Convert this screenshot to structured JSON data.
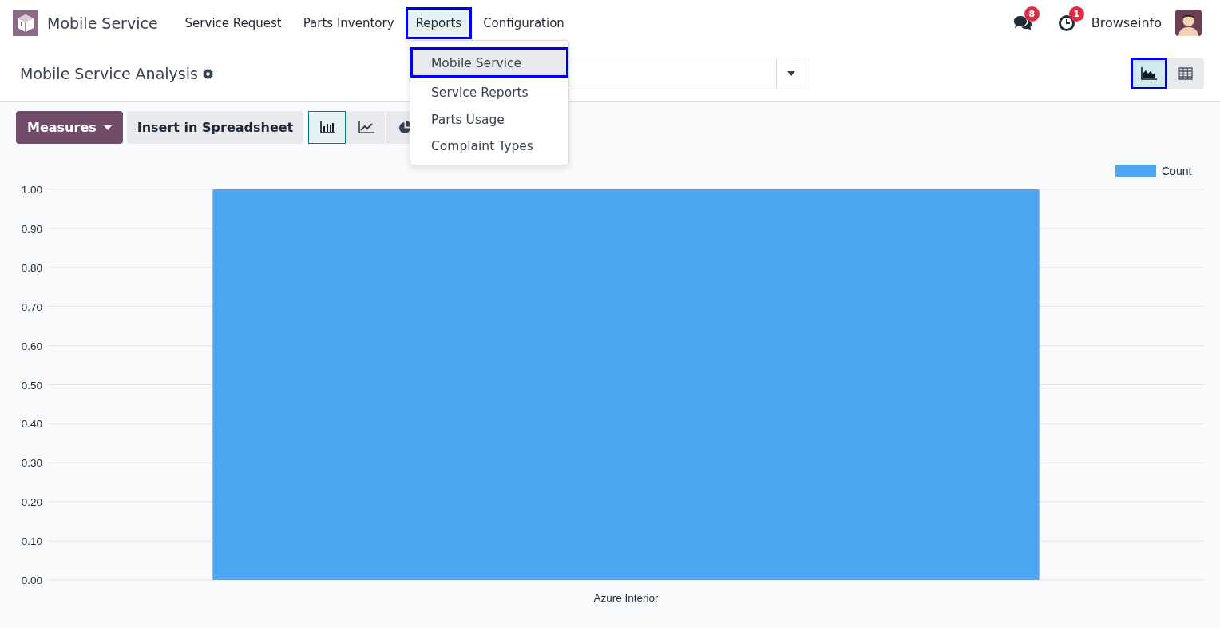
{
  "navbar": {
    "app_name": "Mobile Service",
    "menus": [
      {
        "label": "Service Request",
        "selected": false,
        "highlighted": false
      },
      {
        "label": "Parts Inventory",
        "selected": false,
        "highlighted": false
      },
      {
        "label": "Reports",
        "selected": true,
        "highlighted": true
      },
      {
        "label": "Configuration",
        "selected": false,
        "highlighted": false
      }
    ],
    "systray": [
      {
        "kind": "chat",
        "badge": "8"
      },
      {
        "kind": "activity",
        "badge": "1"
      }
    ],
    "user": "Browseinfo"
  },
  "dropdown": {
    "items": [
      {
        "label": "Mobile Service",
        "selected": true,
        "highlighted": true
      },
      {
        "label": "Service Reports",
        "selected": false,
        "highlighted": false
      },
      {
        "label": "Parts Usage",
        "selected": false,
        "highlighted": false
      },
      {
        "label": "Complaint Types",
        "selected": false,
        "highlighted": false
      }
    ]
  },
  "breadcrumb": {
    "title": "Mobile Service Analysis"
  },
  "view_switcher": [
    {
      "kind": "graph",
      "selected": true,
      "highlighted": true
    },
    {
      "kind": "pivot",
      "selected": false,
      "highlighted": false
    }
  ],
  "toolbar": {
    "measures": "Measures",
    "insert": "Insert in Spreadsheet",
    "chart_types": [
      {
        "kind": "bar",
        "selected": true
      },
      {
        "kind": "line",
        "selected": false
      },
      {
        "kind": "pie",
        "selected": false
      }
    ]
  },
  "chart_data": {
    "type": "bar",
    "grid": true,
    "categories": [
      "Azure Interior"
    ],
    "series": [
      {
        "name": "Count",
        "color": "#4ea7f2",
        "values": [
          1
        ]
      }
    ],
    "ylim": [
      0,
      1
    ],
    "yticks": [
      {
        "value": 0,
        "label": "0.00"
      },
      {
        "value": 0.1,
        "label": "0.10"
      },
      {
        "value": 0.2,
        "label": "0.20"
      },
      {
        "value": 0.3,
        "label": "0.30"
      },
      {
        "value": 0.4,
        "label": "0.40"
      },
      {
        "value": 0.5,
        "label": "0.50"
      },
      {
        "value": 0.6,
        "label": "0.60"
      },
      {
        "value": 0.7,
        "label": "0.70"
      },
      {
        "value": 0.8,
        "label": "0.80"
      },
      {
        "value": 0.9,
        "label": "0.90"
      },
      {
        "value": 1,
        "label": "1.00"
      }
    ]
  }
}
